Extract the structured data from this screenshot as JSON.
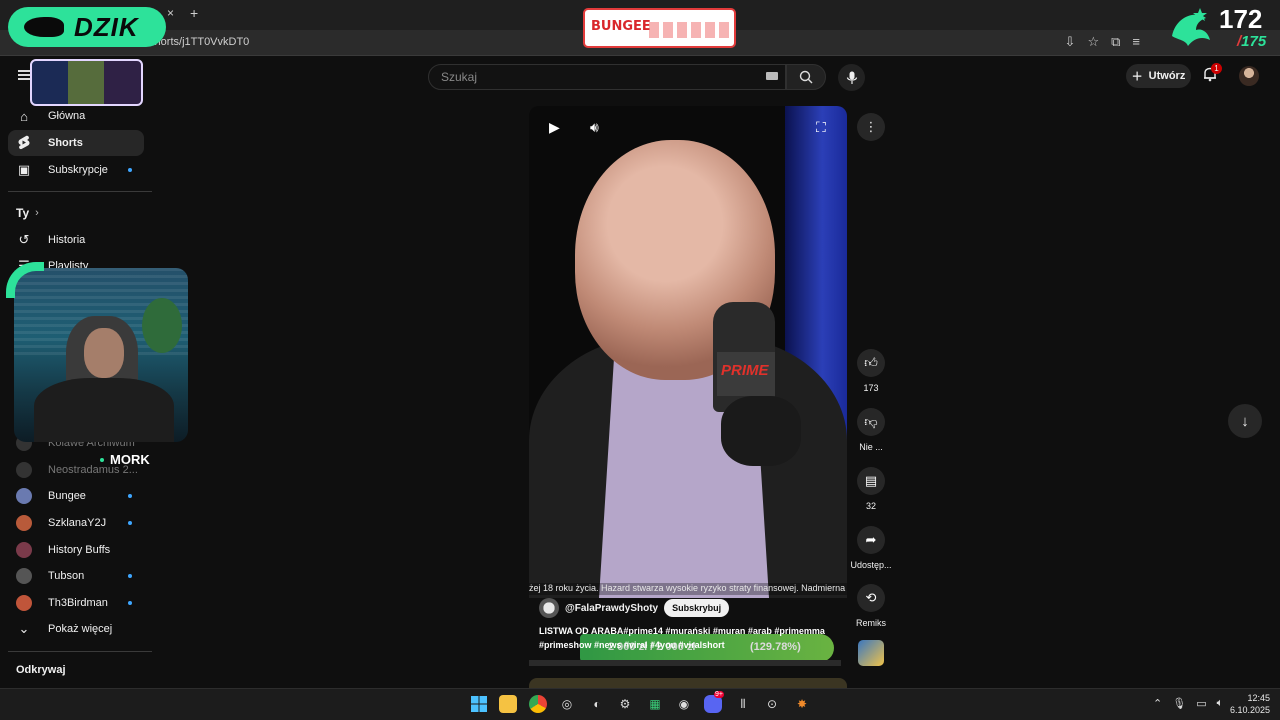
{
  "browser": {
    "url": "/shorts/j1TT0VvkDT0",
    "tab_close": "×",
    "tab_new": "+"
  },
  "overlay": {
    "dzik_text": "DZIK",
    "bungee_logo": "BUNGEE",
    "counter_main": "172",
    "counter_slash": "/",
    "counter_sub": "175",
    "webcam_name": "MORK",
    "progress_text": "2 000 zł / 2 000 zł",
    "progress_pct": "(129.78%)"
  },
  "header": {
    "search_placeholder": "Szukaj",
    "create_label": "Utwórz",
    "notification_count": "1"
  },
  "sidebar": {
    "home": "Główna",
    "shorts": "Shorts",
    "subscriptions": "Subskrypcje",
    "you": "Ty",
    "history": "Historia",
    "playlists": "Playlisty",
    "channels_hidden": [
      "Kolawe Archiwum",
      "Neostradamus 2..."
    ],
    "channels": [
      {
        "name": "Bungee",
        "color": "#6a7ab0",
        "dot": true
      },
      {
        "name": "SzklanaY2J",
        "color": "#b85a3a",
        "dot": true
      },
      {
        "name": "History Buffs",
        "color": "#7a3a4a",
        "dot": false
      },
      {
        "name": "Tubson",
        "color": "#555555",
        "dot": true
      },
      {
        "name": "Th3Birdman",
        "color": "#c0553a",
        "dot": true
      }
    ],
    "show_more": "Pokaż więcej",
    "explore": "Odkrywaj"
  },
  "video": {
    "caption": "żej 18 roku życia. Hazard stwarza wysokie ryzyko straty finansowej. Nadmierna gra",
    "channel": "@FalaPrawdyShoty",
    "subscribe_label": "Subskrybuj",
    "description": "LISTWA OD ARABA#prime14 #murański #muran #arab #primemma #primeshow #news #viral #4you #viralshort",
    "mic_brand": "PRIME"
  },
  "actions": {
    "likes": "173",
    "dislike": "Nie ...",
    "comments": "32",
    "share": "Udostęp...",
    "remix": "Remiks"
  },
  "taskbar": {
    "time": "12:45",
    "date": "6.10.2025",
    "discord_badge": "9+"
  },
  "colors": {
    "accent_green": "#2de29a",
    "yt_red": "#cc0000",
    "subscribed_dot": "#3ea6ff"
  }
}
